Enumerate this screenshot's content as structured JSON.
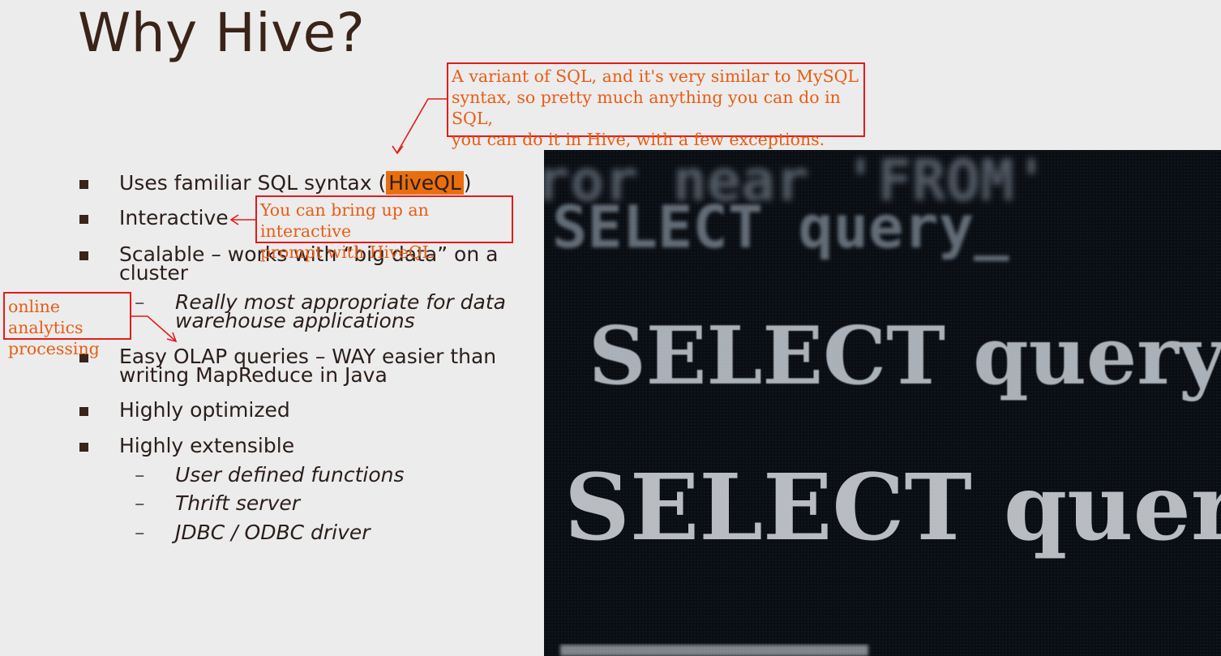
{
  "slide": {
    "title": "Why Hive?",
    "bullets": [
      {
        "pre": "Uses familiar SQL syntax (",
        "highlight": "HiveQL",
        "post": ")"
      },
      {
        "text": "Interactive"
      },
      {
        "line1": "Scalable – works with “big data” on a",
        "line2": "cluster"
      },
      {
        "line1": "Easy OLAP queries – WAY easier than",
        "line2": "writing MapReduce in Java"
      },
      {
        "text": "Highly optimized"
      },
      {
        "text": "Highly extensible"
      }
    ],
    "sub_scalable": {
      "dash": "–",
      "line1": "Really most appropriate for data",
      "line2": "warehouse applications"
    },
    "sub_extensible": [
      {
        "dash": "–",
        "text": "User defined functions"
      },
      {
        "dash": "–",
        "text": "Thrift server"
      },
      {
        "dash": "–",
        "text": "JDBC / ODBC driver"
      }
    ]
  },
  "annotations": {
    "sql_note": [
      "A variant of SQL, and it's very similar to MySQL",
      "syntax, so pretty much anything you can do in SQL,",
      "you can do it in Hive, with a few exceptions."
    ],
    "interactive_note": [
      "You can bring up an interactive",
      "prompt with HiveQL"
    ],
    "olap_note": [
      "online analytics",
      "processing"
    ]
  },
  "photo": {
    "lines": [
      "ror near 'FROM'",
      "SELECT query_",
      "SELECT query",
      "SELECT quer"
    ]
  },
  "colors": {
    "annotation_border": "#e31b1b",
    "annotation_text": "#e85d16",
    "highlight": "#e96f0e",
    "title": "#3a2318"
  }
}
